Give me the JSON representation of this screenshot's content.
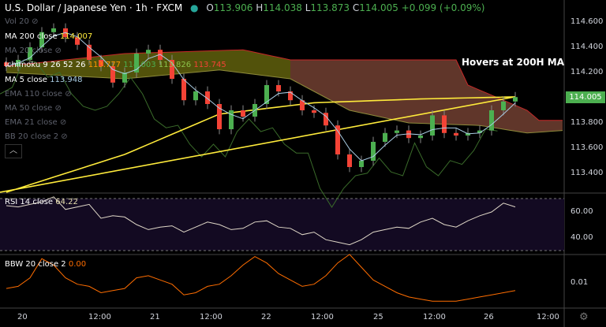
{
  "header": {
    "title": "U.S. Dollar / Japanese Yen · 1h · FXCM",
    "open_label": "O",
    "open": "113.906",
    "high_label": "H",
    "high": "114.038",
    "low_label": "L",
    "low": "113.873",
    "close_label": "C",
    "close": "114.005",
    "change": "+0.099 (+0.09%)"
  },
  "legend": [
    {
      "label": "Vol 20",
      "value": "",
      "hidden": true
    },
    {
      "label": "MA 200 close",
      "value": "114.007",
      "color": "#ffeb3b"
    },
    {
      "label": "MA 20 close",
      "value": "",
      "hidden": true
    },
    {
      "label": "Ichimoku 9 26 52 26",
      "values": [
        "113.777",
        "114.003",
        "113.826",
        "113.745"
      ],
      "colors": [
        "#ff9800",
        "#4caf50",
        "#8bc34a",
        "#f44336"
      ]
    },
    {
      "label": "MA 5 close",
      "value": "113.948",
      "color": "#a9cce3"
    },
    {
      "label": "EMA 110 close",
      "value": "",
      "hidden": true
    },
    {
      "label": "MA 50 close",
      "value": "",
      "hidden": true
    },
    {
      "label": "EMA 21 close",
      "value": "",
      "hidden": true
    },
    {
      "label": "BB 20 close 2",
      "value": "",
      "hidden": true
    }
  ],
  "annotation": "Hovers at 200H MA",
  "last_price": "114.005",
  "rsi": {
    "label": "RSI 14 close",
    "value": "64.22",
    "ticks": [
      "60.00",
      "40.00"
    ]
  },
  "bbw": {
    "label": "BBW 20 close 2",
    "value": "0.00",
    "ticks": [
      "0.01"
    ]
  },
  "chart_data": {
    "type": "candlestick",
    "price_ticks": [
      "114.600",
      "114.400",
      "114.200",
      "113.800",
      "113.600",
      "113.400"
    ],
    "ylim": [
      113.3,
      114.7
    ],
    "time_ticks": [
      "20",
      "12:00",
      "21",
      "12:00",
      "22",
      "12:00",
      "25",
      "12:00",
      "26",
      "12:00"
    ],
    "closes": [
      114.25,
      114.3,
      114.4,
      114.52,
      114.55,
      114.48,
      114.42,
      114.3,
      114.25,
      114.12,
      114.2,
      114.35,
      114.38,
      114.3,
      114.15,
      113.98,
      114.05,
      113.95,
      113.75,
      113.9,
      113.85,
      113.95,
      114.1,
      114.05,
      113.98,
      113.9,
      113.88,
      113.78,
      113.55,
      113.45,
      113.5,
      113.65,
      113.72,
      113.74,
      113.68,
      113.7,
      113.86,
      113.72,
      113.7,
      113.72,
      113.74,
      113.9,
      113.97,
      114.005
    ],
    "ma200": [
      [
        0,
        113.25
      ],
      [
        10,
        113.55
      ],
      [
        18,
        113.87
      ],
      [
        26,
        113.96
      ],
      [
        35,
        113.99
      ],
      [
        43,
        114.007
      ]
    ],
    "span_a": [
      [
        0,
        114.2
      ],
      [
        10,
        114.15
      ],
      [
        18,
        114.22
      ],
      [
        24,
        114.15
      ],
      [
        29,
        113.9
      ],
      [
        34,
        113.8
      ],
      [
        40,
        113.78
      ],
      [
        44,
        113.72
      ],
      [
        47,
        113.74
      ]
    ],
    "span_b": [
      [
        0,
        114.25
      ],
      [
        10,
        114.35
      ],
      [
        20,
        114.38
      ],
      [
        24,
        114.3
      ],
      [
        38,
        114.3
      ],
      [
        39,
        114.1
      ],
      [
        44,
        113.9
      ],
      [
        45,
        113.82
      ],
      [
        47,
        113.82
      ]
    ],
    "rsi_values": [
      65,
      64,
      66,
      68,
      72,
      62,
      64,
      66,
      55,
      57,
      56,
      50,
      46,
      48,
      49,
      44,
      48,
      52,
      50,
      46,
      47,
      52,
      53,
      48,
      47,
      42,
      44,
      38,
      36,
      34,
      38,
      44,
      46,
      48,
      47,
      52,
      55,
      50,
      48,
      53,
      57,
      60,
      67,
      64
    ],
    "bbw_values": [
      0.0085,
      0.009,
      0.011,
      0.0155,
      0.014,
      0.011,
      0.0095,
      0.009,
      0.0075,
      0.008,
      0.0085,
      0.011,
      0.0115,
      0.0105,
      0.0095,
      0.007,
      0.0075,
      0.009,
      0.0095,
      0.0115,
      0.014,
      0.016,
      0.0145,
      0.012,
      0.0105,
      0.009,
      0.0095,
      0.0115,
      0.0145,
      0.0165,
      0.0135,
      0.0105,
      0.009,
      0.0075,
      0.0065,
      0.006,
      0.0055,
      0.0055,
      0.0055,
      0.006,
      0.0065,
      0.007,
      0.0075,
      0.008
    ]
  },
  "colors": {
    "up": "#4caf50",
    "down": "#f44336",
    "ma200": "#ffeb3b",
    "ma5": "#a9cce3",
    "rsi": "#e0d8c8",
    "bbw": "#ff6d00"
  }
}
